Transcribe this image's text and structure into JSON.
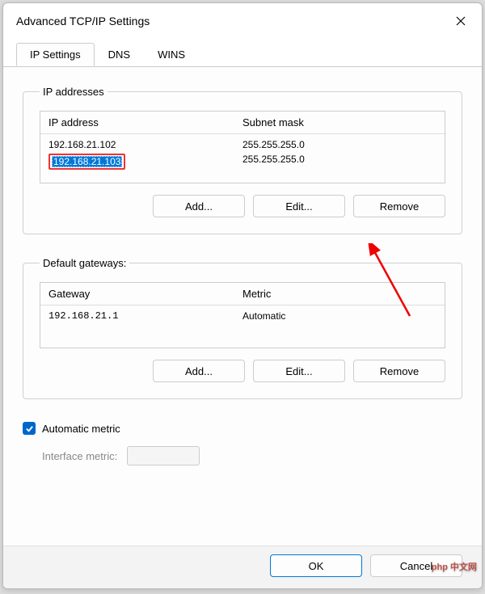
{
  "window": {
    "title": "Advanced TCP/IP Settings"
  },
  "tabs": [
    {
      "label": "IP Settings",
      "active": true
    },
    {
      "label": "DNS",
      "active": false
    },
    {
      "label": "WINS",
      "active": false
    }
  ],
  "ip_addresses": {
    "legend": "IP addresses",
    "headers": {
      "col1": "IP address",
      "col2": "Subnet mask"
    },
    "rows": [
      {
        "ip": "192.168.21.102",
        "mask": "255.255.255.0",
        "selected": false
      },
      {
        "ip": "192.168.21.103",
        "mask": "255.255.255.0",
        "selected": true
      }
    ],
    "buttons": {
      "add": "Add...",
      "edit": "Edit...",
      "remove": "Remove"
    }
  },
  "gateways": {
    "legend": "Default gateways:",
    "headers": {
      "col1": "Gateway",
      "col2": "Metric"
    },
    "rows": [
      {
        "gw": "192.168.21.1",
        "metric": "Automatic"
      }
    ],
    "buttons": {
      "add": "Add...",
      "edit": "Edit...",
      "remove": "Remove"
    }
  },
  "metric": {
    "auto_label": "Automatic metric",
    "auto_checked": true,
    "interface_label": "Interface metric:",
    "interface_value": ""
  },
  "footer": {
    "ok": "OK",
    "cancel": "Cancel"
  },
  "watermark": "php 中文网"
}
